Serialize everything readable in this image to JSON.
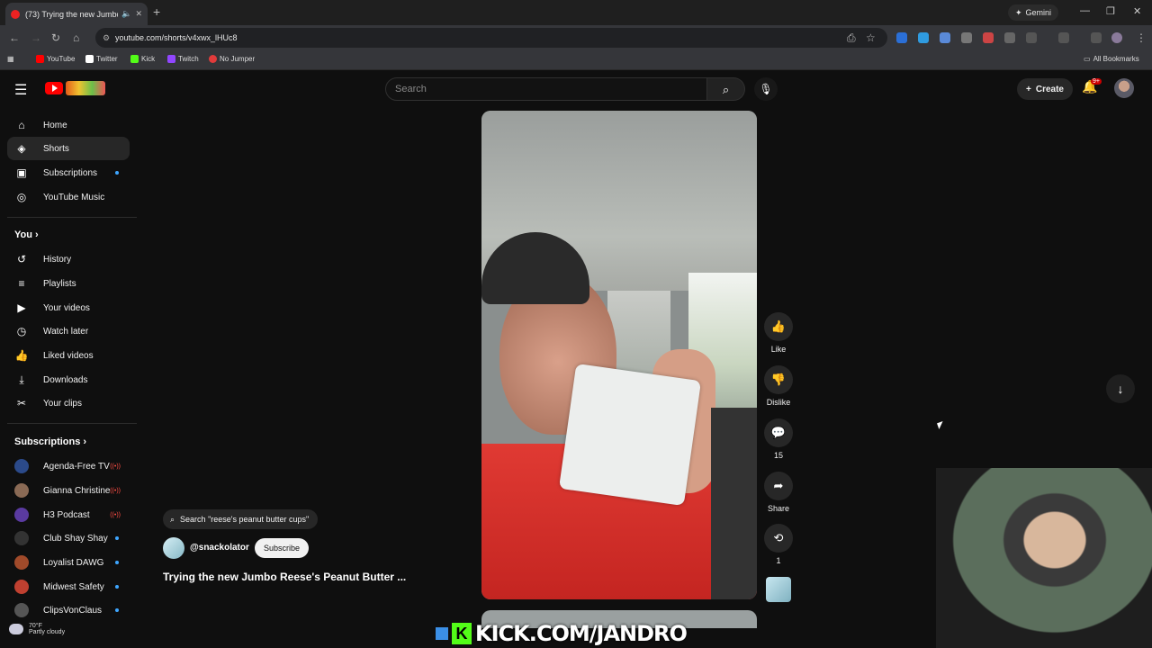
{
  "browser": {
    "tab_title": "(73) Trying the new Jumbo",
    "gemini_label": "Gemini",
    "url": "youtube.com/shorts/v4xwx_lHUc8"
  },
  "bookmarks": [
    {
      "label": "YouTube",
      "color": "#ff0000"
    },
    {
      "label": "Twitter",
      "color": "#ffffff"
    },
    {
      "label": "Kick",
      "color": "#53fc18"
    },
    {
      "label": "Twitch",
      "color": "#9146ff"
    },
    {
      "label": "No Jumper",
      "color": "#e23b3b"
    }
  ],
  "all_bookmarks_label": "All Bookmarks",
  "search": {
    "placeholder": "Search"
  },
  "header": {
    "create_label": "Create",
    "notification_badge": "9+"
  },
  "sidebar": {
    "main": [
      {
        "label": "Home",
        "icon": "home-icon"
      },
      {
        "label": "Shorts",
        "icon": "shorts-icon",
        "active": true
      },
      {
        "label": "Subscriptions",
        "icon": "subscriptions-icon",
        "dot": true
      },
      {
        "label": "YouTube Music",
        "icon": "music-icon"
      }
    ],
    "you_header": "You",
    "you": [
      {
        "label": "History",
        "icon": "history-icon"
      },
      {
        "label": "Playlists",
        "icon": "playlists-icon"
      },
      {
        "label": "Your videos",
        "icon": "your-videos-icon"
      },
      {
        "label": "Watch later",
        "icon": "watch-later-icon"
      },
      {
        "label": "Liked videos",
        "icon": "like-icon"
      },
      {
        "label": "Downloads",
        "icon": "download-icon"
      },
      {
        "label": "Your clips",
        "icon": "scissors-icon"
      }
    ],
    "subs_header": "Subscriptions",
    "subscriptions": [
      {
        "label": "Agenda-Free TV",
        "status": "live",
        "color": "#2b4a8a"
      },
      {
        "label": "Gianna Christine",
        "status": "live",
        "color": "#8a6a55"
      },
      {
        "label": "H3 Podcast",
        "status": "live",
        "color": "#5a3aa0"
      },
      {
        "label": "Club Shay Shay",
        "status": "dot",
        "color": "#333333"
      },
      {
        "label": "Loyalist DAWG",
        "status": "dot",
        "color": "#a04a2a"
      },
      {
        "label": "Midwest Safety",
        "status": "dot",
        "color": "#c04030"
      },
      {
        "label": "ClipsVonClaus",
        "status": "dot",
        "color": "#555555"
      }
    ]
  },
  "short": {
    "search_suggestion": "Search \"reese's peanut butter cups\"",
    "channel": "@snackolator",
    "subscribe_label": "Subscribe",
    "title": "Trying the new Jumbo Reese's Peanut Butter ...",
    "actions": {
      "like": "Like",
      "dislike": "Dislike",
      "comments": "15",
      "share": "Share",
      "remix": "1"
    }
  },
  "overlay": {
    "kick_text": "KICK.COM/JANDRO"
  },
  "weather": {
    "temp": "70°F",
    "condition": "Partly cloudy"
  }
}
